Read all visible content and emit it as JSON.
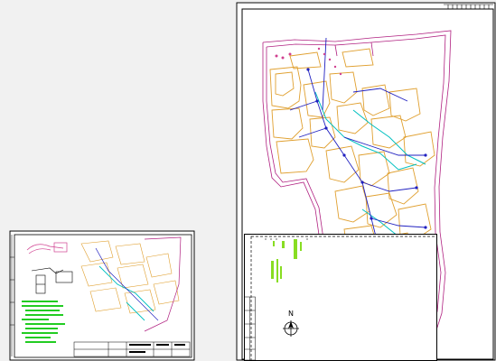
{
  "viewport": {
    "background": "#f1f1f1"
  },
  "drawing_large": {
    "name": "site-plan",
    "north_label": "N",
    "colors": {
      "border": "#000000",
      "block": "#e0a030",
      "boundary": "#b02080",
      "pipe": "#2020c0",
      "green": "#00c0c0"
    }
  },
  "drawing_small": {
    "name": "site-plan-overview",
    "note_color": "#22cc22"
  },
  "overlay_sheet": {
    "name": "overlay-drawing",
    "highlight_color": "#88dd22",
    "north_label": "N"
  }
}
